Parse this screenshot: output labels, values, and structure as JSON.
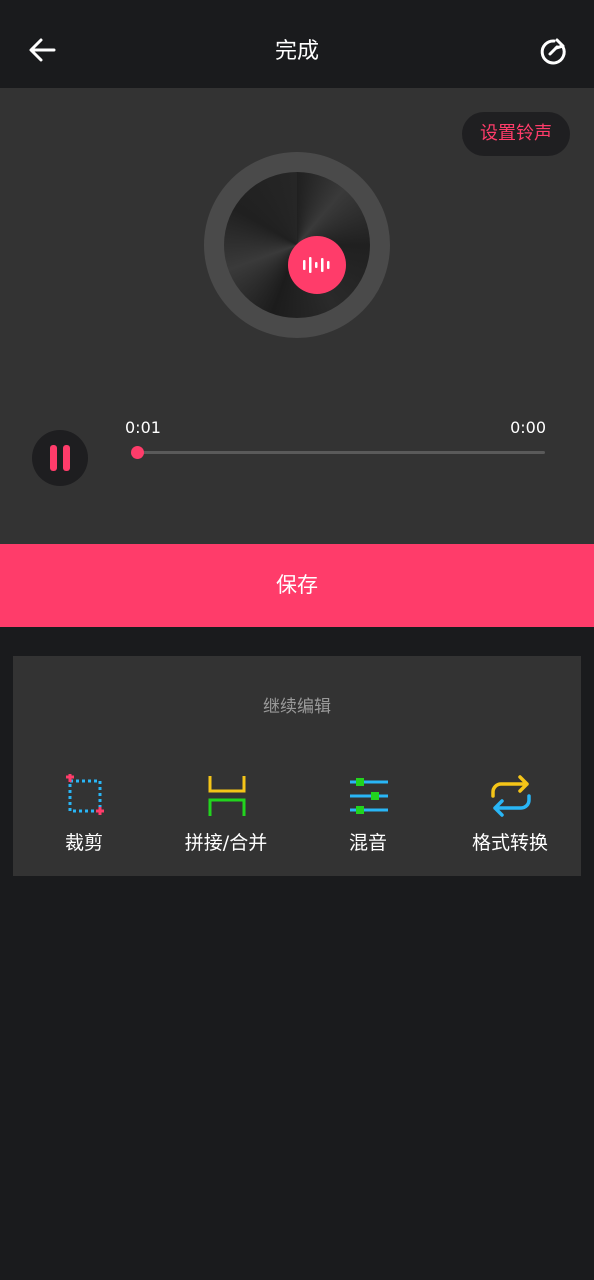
{
  "header": {
    "title": "完成",
    "back_icon": "arrow-left-icon",
    "redo_icon": "redo-icon"
  },
  "player": {
    "ringtone_label": "设置铃声",
    "current_time": "0:01",
    "total_time": "0:00",
    "progress": 0.0,
    "center_icon": "waveform-icon",
    "pause_icon": "pause-icon"
  },
  "save": {
    "label": "保存"
  },
  "edit": {
    "title": "继续编辑",
    "tools": [
      {
        "label": "裁剪",
        "icon": "crop-icon",
        "color": "#29b6f6"
      },
      {
        "label": "拼接/合并",
        "icon": "merge-icon",
        "color": "#f5c518"
      },
      {
        "label": "混音",
        "icon": "mixer-icon",
        "color": "#29b6f6"
      },
      {
        "label": "格式转换",
        "icon": "convert-icon",
        "color": "#f5c518"
      }
    ]
  },
  "colors": {
    "accent": "#ff3c6a",
    "background": "#1a1b1d",
    "panel": "#333333",
    "green": "#22d41e"
  }
}
